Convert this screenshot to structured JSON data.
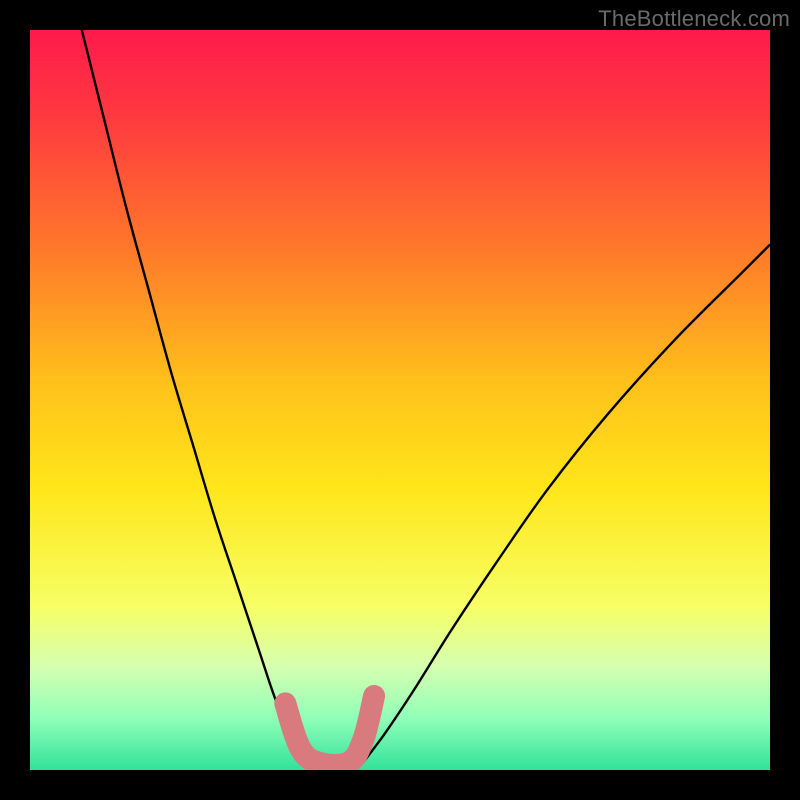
{
  "watermark": "TheBottleneck.com",
  "chart_data": {
    "type": "line",
    "title": "",
    "xlabel": "",
    "ylabel": "",
    "xlim": [
      0,
      100
    ],
    "ylim": [
      0,
      100
    ],
    "grid": false,
    "legend": false,
    "background": {
      "type": "vertical-gradient",
      "stops": [
        {
          "offset": 0.0,
          "color": "#ff1a4b"
        },
        {
          "offset": 0.12,
          "color": "#ff3a3f"
        },
        {
          "offset": 0.3,
          "color": "#ff7a2a"
        },
        {
          "offset": 0.48,
          "color": "#ffc21a"
        },
        {
          "offset": 0.62,
          "color": "#ffe61a"
        },
        {
          "offset": 0.78,
          "color": "#f6ff66"
        },
        {
          "offset": 0.86,
          "color": "#d6ffb0"
        },
        {
          "offset": 0.93,
          "color": "#90ffb8"
        },
        {
          "offset": 1.0,
          "color": "#32e29a"
        }
      ]
    },
    "series": [
      {
        "name": "left-branch",
        "stroke": "#000000",
        "stroke_width": 2.4,
        "x": [
          7,
          10,
          13,
          16,
          19,
          22,
          25,
          28,
          31,
          33,
          35,
          37
        ],
        "y": [
          100,
          88,
          76,
          65,
          54,
          44,
          34,
          25,
          16,
          10,
          5,
          1
        ]
      },
      {
        "name": "right-branch",
        "stroke": "#000000",
        "stroke_width": 2.4,
        "x": [
          45,
          48,
          52,
          57,
          63,
          70,
          78,
          87,
          96,
          100
        ],
        "y": [
          1,
          5,
          11,
          19,
          28,
          38,
          48,
          58,
          67,
          71
        ]
      },
      {
        "name": "valley-marker",
        "stroke": "#d97a7f",
        "stroke_width": 22,
        "linecap": "round",
        "x": [
          34.5,
          36.5,
          39,
          43,
          45,
          46.5
        ],
        "y": [
          9,
          3,
          1,
          1,
          4,
          10
        ]
      }
    ]
  }
}
